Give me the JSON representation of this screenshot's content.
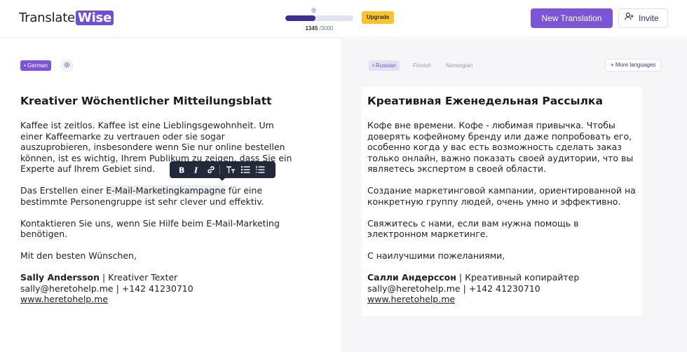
{
  "header": {
    "logo_main": "Translate",
    "logo_accent": "Wise",
    "usage_used": "1345",
    "usage_total": " /3000",
    "usage_progress": 0.448,
    "upgrade_label": "Upgrade",
    "new_translation_label": "New Translation",
    "invite_label": "Invite"
  },
  "source": {
    "language": "German",
    "title": "Kreativer Wöchentlicher Mitteilungsblatt",
    "paragraphs": [
      "Kaffee ist zeitlos. Kaffee ist eine Lieblingsgewohnheit. Um einer Kaffeemarke zu vertrauen oder sie sogar auszuprobieren, insbesondere wenn Sie nur online bestellen können, ist es wichtig, Ihrem Publikum zu zeigen, dass Sie ein Experte auf Ihrem Gebiet sind.",
      "Kontaktieren Sie uns, wenn Sie Hilfe beim E-Mail-Marketing benötigen.",
      "Mit den besten Wünschen,"
    ],
    "p2_before": "Das Erstellen einer ",
    "p2_highlight": "E-Mail-Marketingkampagne",
    "p2_after": " für eine bestimmte Personengruppe ist sehr clever und effektiv.",
    "sig_name": "Sally Andersson",
    "sig_role": " | Kreativer Texter",
    "sig_contact": "sally@heretohelp.me | +142 41230710",
    "sig_link": "www.heretohelp.me"
  },
  "target": {
    "active_language": "Russian",
    "other_languages": [
      "Finnish",
      "Norwegian"
    ],
    "more_languages_label": "More languages",
    "title": "Креативная Еженедельная Рассылка",
    "paragraphs": [
      "Кофе вне времени. Кофе - любимая привычка. Чтобы доверять кофейному бренду или даже попробовать его, особенно когда у вас есть возможность сделать заказ только онлайн, важно показать своей аудитории, что вы являетесь экспертом в своей области.",
      "Создание маркетинговой кампании, ориентированной на конкретную группу людей, очень умно и эффективно.",
      "Свяжитесь с нами, если вам нужна помощь в электронном маркетинге.",
      "С наилучшими пожеланиями,"
    ],
    "sig_name": "Салли Андерссон",
    "sig_role": " | Креативный копирайтер",
    "sig_contact": "sally@heretohelp.me | +142 41230710",
    "sig_link": "www.heretohelp.me"
  },
  "toolbar": {
    "icons": [
      "bold-icon",
      "italic-icon",
      "link-icon",
      "text-size-icon",
      "bullet-list-icon",
      "numbered-list-icon"
    ]
  }
}
